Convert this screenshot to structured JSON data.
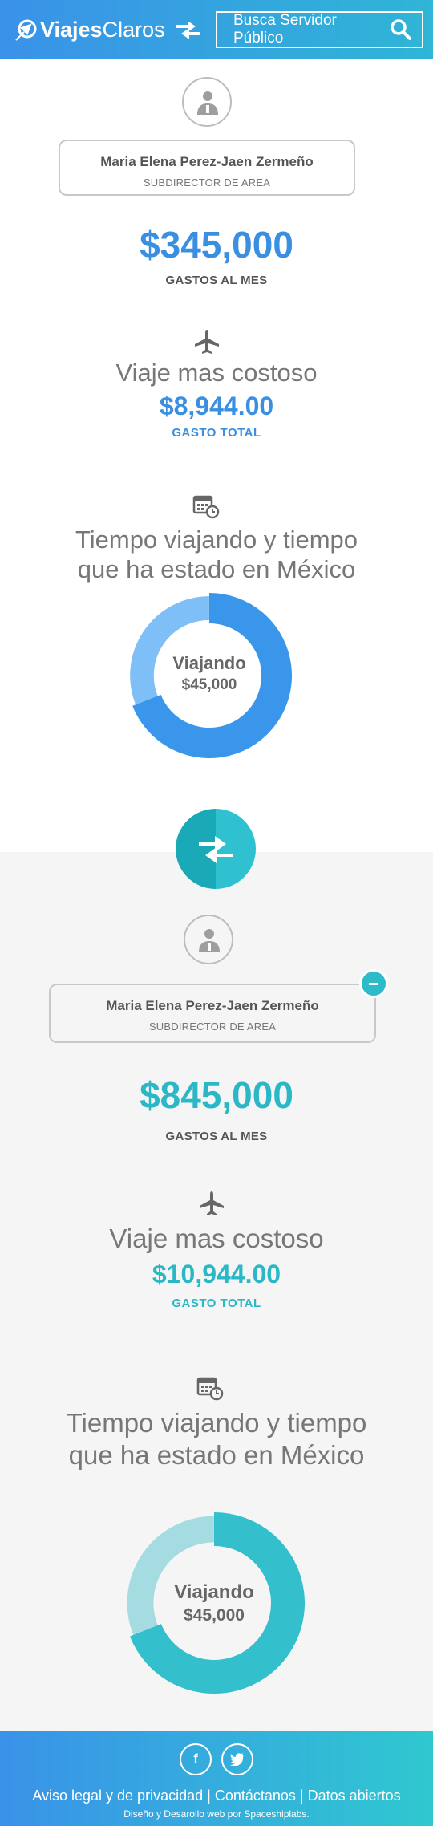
{
  "header": {
    "logo_bold": "Viajes",
    "logo_light": "Claros",
    "search_placeholder": "Busca Servidor Público"
  },
  "official_a": {
    "name": "Maria Elena Perez-Jaen Zermeño",
    "position": "SUBDIRECTOR DE AREA",
    "monthly_amount": "$345,000",
    "monthly_label": "GASTOS AL MES",
    "trip_title": "Viaje mas costoso",
    "trip_amount": "$8,944.00",
    "trip_label": "GASTO TOTAL",
    "time_title_line1": "Tiempo viajando y tiempo",
    "time_title_line2": "que ha estado en México",
    "donut_label": "Viajando",
    "donut_value": "$45,000",
    "donut_travel_fraction": 0.69,
    "colors": {
      "travel": "#3996ea",
      "home": "#7dbff6"
    }
  },
  "official_b": {
    "name": "Maria Elena Perez-Jaen Zermeño",
    "position": "SUBDIRECTOR DE AREA",
    "monthly_amount": "$845,000",
    "monthly_label": "GASTOS AL MES",
    "trip_title": "Viaje mas costoso",
    "trip_amount": "$10,944.00",
    "trip_label": "GASTO TOTAL",
    "time_title_line1": "Tiempo viajando y tiempo",
    "time_title_line2": "que ha estado en México",
    "donut_label": "Viajando",
    "donut_value": "$45,000",
    "donut_travel_fraction": 0.69,
    "colors": {
      "travel": "#33bfcc",
      "home": "#a4dce2"
    }
  },
  "footer": {
    "social": [
      "facebook",
      "twitter"
    ],
    "link_privacy": "Aviso legal y de privacidad",
    "separator": "|",
    "link_contact": "Contáctanos",
    "link_data": "Datos abiertos",
    "credit": "Diseño y Desarollo web por Spaceshiplabs."
  }
}
